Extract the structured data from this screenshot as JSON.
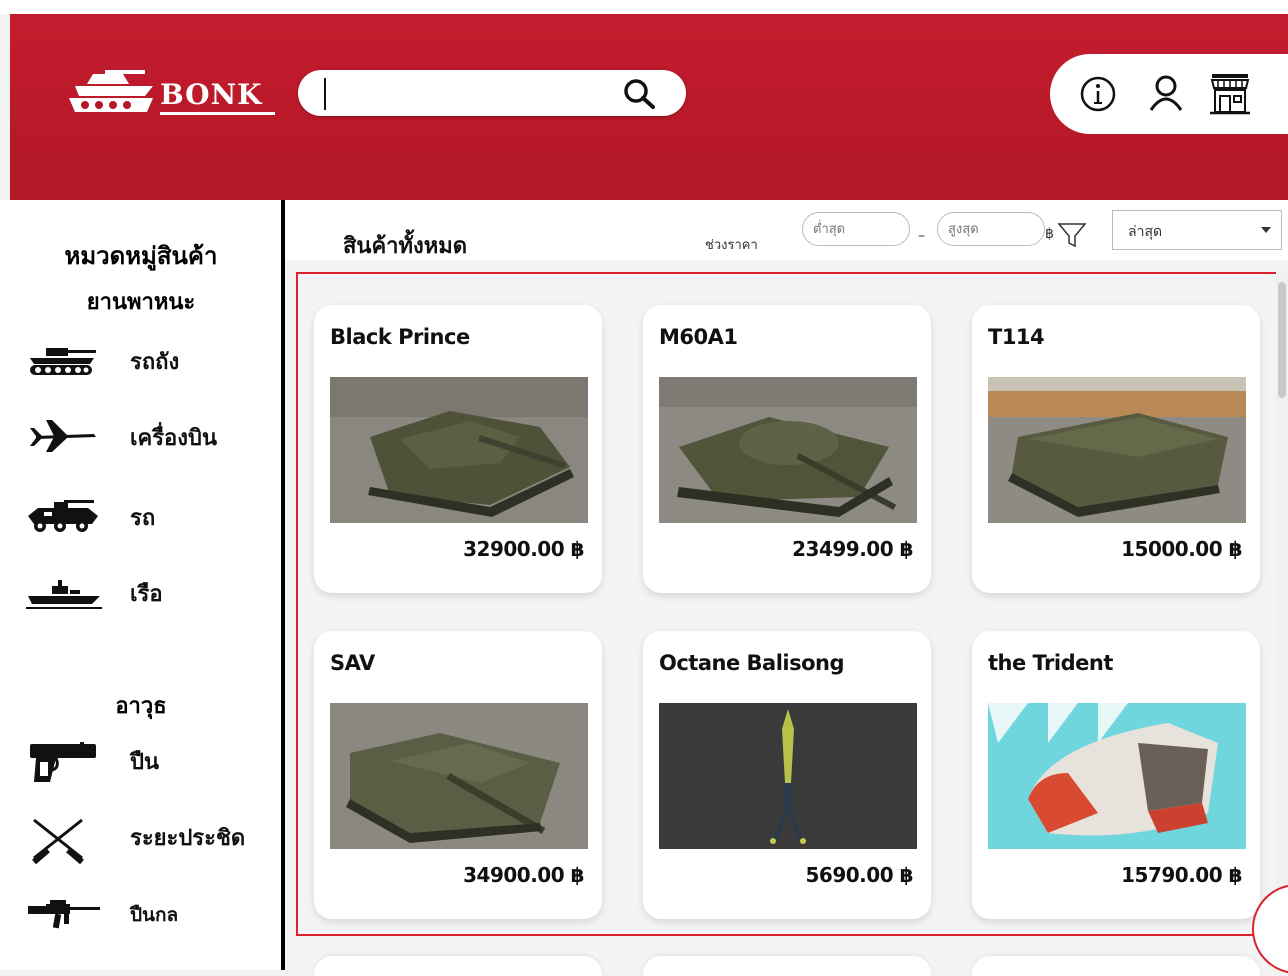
{
  "header": {
    "logo_text": "BONK",
    "search": {
      "value": "",
      "placeholder": ""
    },
    "icons": [
      "info-icon",
      "user-icon",
      "shop-icon"
    ]
  },
  "sidebar": {
    "title": "หมวดหมู่สินค้า",
    "vehicles_title": "ยานพาหนะ",
    "vehicles": [
      {
        "label": "รถถัง",
        "icon": "tank-icon"
      },
      {
        "label": "เครื่องบิน",
        "icon": "jet-icon"
      },
      {
        "label": "รถ",
        "icon": "armored-car-icon"
      },
      {
        "label": "เรือ",
        "icon": "ship-icon"
      }
    ],
    "weapons_title": "อาวุธ",
    "weapons": [
      {
        "label": "ปืน",
        "icon": "pistol-icon"
      },
      {
        "label": "ระยะประชิด",
        "icon": "crossed-knives-icon"
      },
      {
        "label": "ปืนกล",
        "icon": "rifle-icon"
      }
    ]
  },
  "toolbar": {
    "title": "สินค้าทั้งหมด",
    "price_range_label": "ช่วงราคา",
    "min_placeholder": "ต่ำสุด",
    "max_placeholder": "สูงสุด",
    "dash": "–",
    "currency": "฿",
    "sort_value": "ล่าสุด"
  },
  "products": [
    {
      "name": "Black Prince",
      "price": "32900.00 ฿",
      "image": "tank-render"
    },
    {
      "name": "M60A1",
      "price": "23499.00 ฿",
      "image": "tank-render"
    },
    {
      "name": "T114",
      "price": "15000.00 ฿",
      "image": "apc-render"
    },
    {
      "name": "SAV",
      "price": "34900.00 ฿",
      "image": "tank-destroyer-render"
    },
    {
      "name": "Octane Balisong",
      "price": "5690.00 ฿",
      "image": "balisong-render"
    },
    {
      "name": "the Trident",
      "price": "15790.00 ฿",
      "image": "trident-ship-render"
    }
  ],
  "colors": {
    "brand_red": "#c41c2e",
    "highlight": "#d9232f"
  }
}
